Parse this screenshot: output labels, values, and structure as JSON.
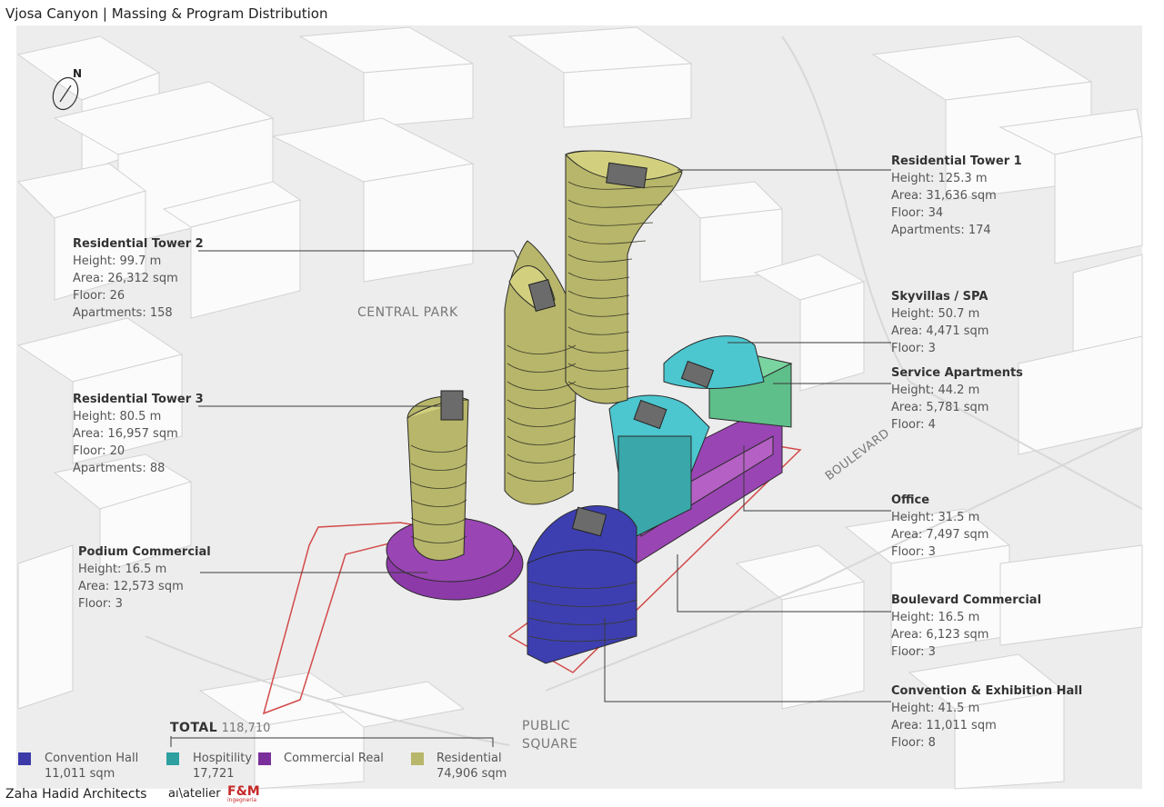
{
  "title": "Vjosa Canyon | Massing & Program Distribution",
  "compass": "N",
  "map_labels": {
    "park": "CENTRAL PARK",
    "boulevard": "BOULEVARD",
    "square_1": "PUBLIC",
    "square_2": "SQUARE"
  },
  "towers": [
    {
      "name": "Residential Tower 1",
      "height": "Height: 125.3 m",
      "area": "Area: 31,636 sqm",
      "floor": "Floor: 34",
      "apts": "Apartments: 174"
    },
    {
      "name": "Residential Tower 2",
      "height": "Height: 99.7 m",
      "area": "Area: 26,312 sqm",
      "floor": "Floor: 26",
      "apts": "Apartments: 158"
    },
    {
      "name": "Residential Tower 3",
      "height": "Height: 80.5 m",
      "area": "Area: 16,957 sqm",
      "floor": "Floor: 20",
      "apts": "Apartments: 88"
    },
    {
      "name": "Skyvillas / SPA",
      "height": "Height: 50.7 m",
      "area": "Area: 4,471 sqm",
      "floor": "Floor: 3"
    },
    {
      "name": "Service Apartments",
      "height": "Height: 44.2 m",
      "area": "Area: 5,781 sqm",
      "floor": "Floor: 4"
    },
    {
      "name": "Podium Commercial",
      "height": "Height: 16.5 m",
      "area": "Area: 12,573 sqm",
      "floor": "Floor: 3"
    },
    {
      "name": "Office",
      "height": "Height: 31.5 m",
      "area": "Area: 7,497 sqm",
      "floor": "Floor: 3"
    },
    {
      "name": "Boulevard Commercial",
      "height": "Height: 16.5 m",
      "area": "Area: 6,123 sqm",
      "floor": "Floor: 3"
    },
    {
      "name": "Convention & Exhibition Hall",
      "height": "Height: 41.5 m",
      "area": "Area: 11,011 sqm",
      "floor": "Floor: 8"
    }
  ],
  "total": {
    "label": "TOTAL",
    "value": "118,710"
  },
  "legend": [
    {
      "name": "Convention Hall",
      "value": "11,011 sqm",
      "color": "#3b3aa8"
    },
    {
      "name": "Hospitility",
      "value": "17,721",
      "color": "#2fa0a0"
    },
    {
      "name": "Commercial Real",
      "value": "",
      "color": "#7b2f9a"
    },
    {
      "name": "Residential",
      "value": "74,906 sqm",
      "color": "#b8b66a"
    }
  ],
  "colors": {
    "residential": "#c9c774",
    "hospitality": "#4cc6cf",
    "service": "#5fbf8a",
    "commercial": "#9a45b4",
    "convention": "#3d3fb0"
  },
  "footer": {
    "firm": "Zaha Hadid Architects",
    "partner1": "aı\\atelier",
    "partner2": "F&M",
    "partner2_sub": "ingegneria"
  }
}
